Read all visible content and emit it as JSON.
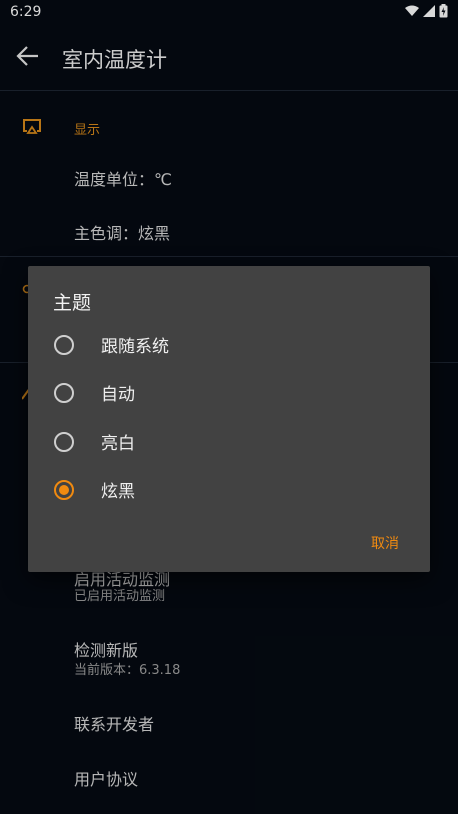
{
  "status_bar": {
    "time": "6:29"
  },
  "toolbar": {
    "title": "室内温度计"
  },
  "sections": {
    "display": {
      "title": "显示",
      "unit_label": "温度单位：℃",
      "color_label": "主色调：炫黑"
    }
  },
  "list": {
    "activity_title": "启用活动监测",
    "activity_sub": "已启用活动监测",
    "update_title": "检测新版",
    "update_sub": "当前版本：6.3.18",
    "contact": "联系开发者",
    "agreement": "用户协议"
  },
  "dialog": {
    "title": "主题",
    "options": [
      "跟随系统",
      "自动",
      "亮白",
      "炫黑"
    ],
    "selected": "炫黑",
    "cancel": "取消"
  },
  "colors": {
    "accent": "#f08a10",
    "background": "#050a12",
    "dialog": "#424242"
  }
}
